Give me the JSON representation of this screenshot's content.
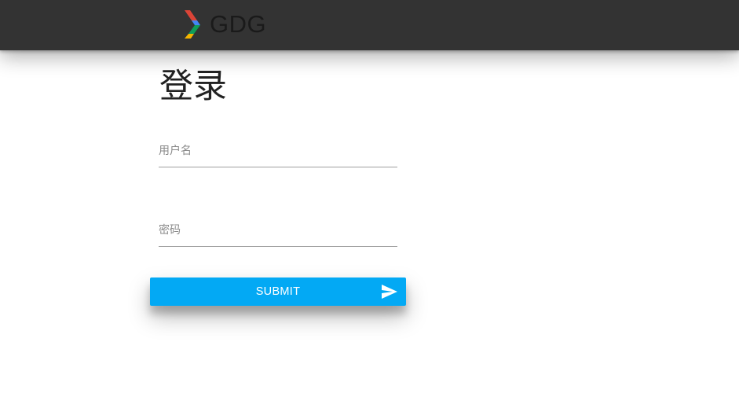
{
  "header": {
    "logo_text": "GDG",
    "logo_icon": "gdg-chevron-logo-icon",
    "background_color": "#333333"
  },
  "login": {
    "title": "登录",
    "username": {
      "placeholder": "用户名",
      "value": ""
    },
    "password": {
      "placeholder": "密码",
      "value": ""
    },
    "submit": {
      "label": "SUBMIT",
      "icon": "send-icon",
      "color": "#03a9f4"
    }
  }
}
